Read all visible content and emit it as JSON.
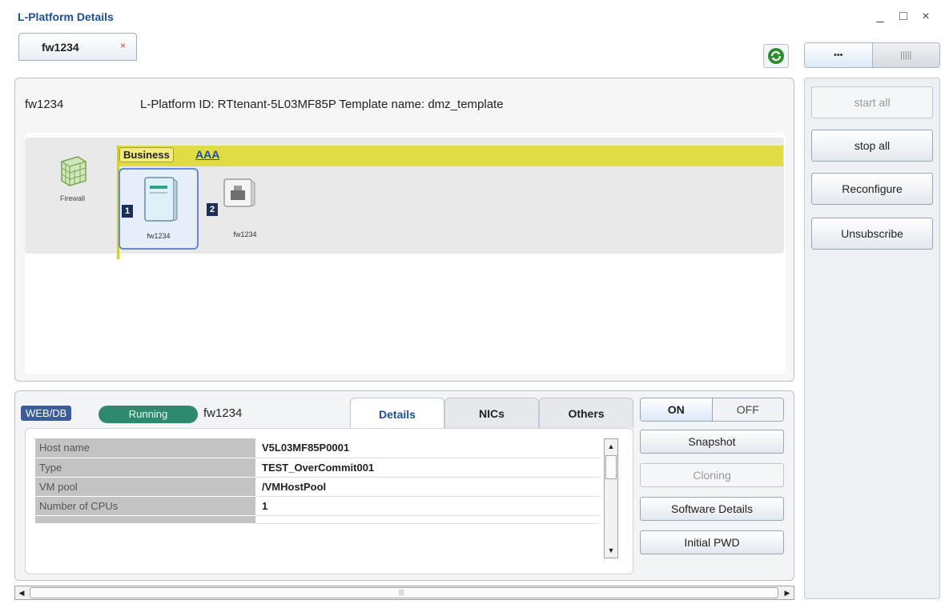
{
  "window": {
    "title": "L-Platform Details",
    "controls": {
      "minimize": "_",
      "maximize": "□",
      "close": "×"
    }
  },
  "tab": {
    "label": "fw1234",
    "close": "×"
  },
  "toolbar": {
    "refresh_icon": "refresh-icon",
    "view_toggle": [
      {
        "label": "•••",
        "active": true
      },
      {
        "label": "|||||",
        "active": false
      }
    ]
  },
  "platform": {
    "name": "fw1234",
    "info_line": "L-Platform ID: RTtenant-5L03MF85P  Template name: dmz_template"
  },
  "topology": {
    "firewall": {
      "label": "Firewall",
      "icon": "firewall-icon"
    },
    "segment": {
      "tag": "Business",
      "link": "AAA"
    },
    "servers": [
      {
        "number": "1",
        "name": "fw1234",
        "selected": true,
        "icon": "server-icon"
      },
      {
        "number": "2",
        "name": "fw1234",
        "selected": false,
        "icon": "server-stopped-icon"
      }
    ]
  },
  "side_actions": {
    "start_all": "start all",
    "stop_all": "stop all",
    "reconfigure": "Reconfigure",
    "unsubscribe": "Unsubscribe"
  },
  "lower": {
    "role": "WEB/DB",
    "status": "Running",
    "name": "fw1234",
    "tabs": [
      "Details",
      "NICs",
      "Others"
    ],
    "details": [
      {
        "key": "Host name",
        "value": "V5L03MF85P0001"
      },
      {
        "key": "Type",
        "value": "TEST_OverCommit001"
      },
      {
        "key": "VM pool",
        "value": "/VMHostPool"
      },
      {
        "key": "Number of CPUs",
        "value": "1"
      }
    ],
    "power": {
      "on": "ON",
      "off": "OFF"
    },
    "actions": {
      "snapshot": "Snapshot",
      "cloning": "Cloning",
      "software_details": "Software Details",
      "initial_pwd": "Initial PWD"
    }
  },
  "colors": {
    "title": "#1f4f93",
    "segment_bar": "#e0dc44",
    "status_running": "#2e8a6c",
    "role_badge": "#3b5d9c"
  }
}
